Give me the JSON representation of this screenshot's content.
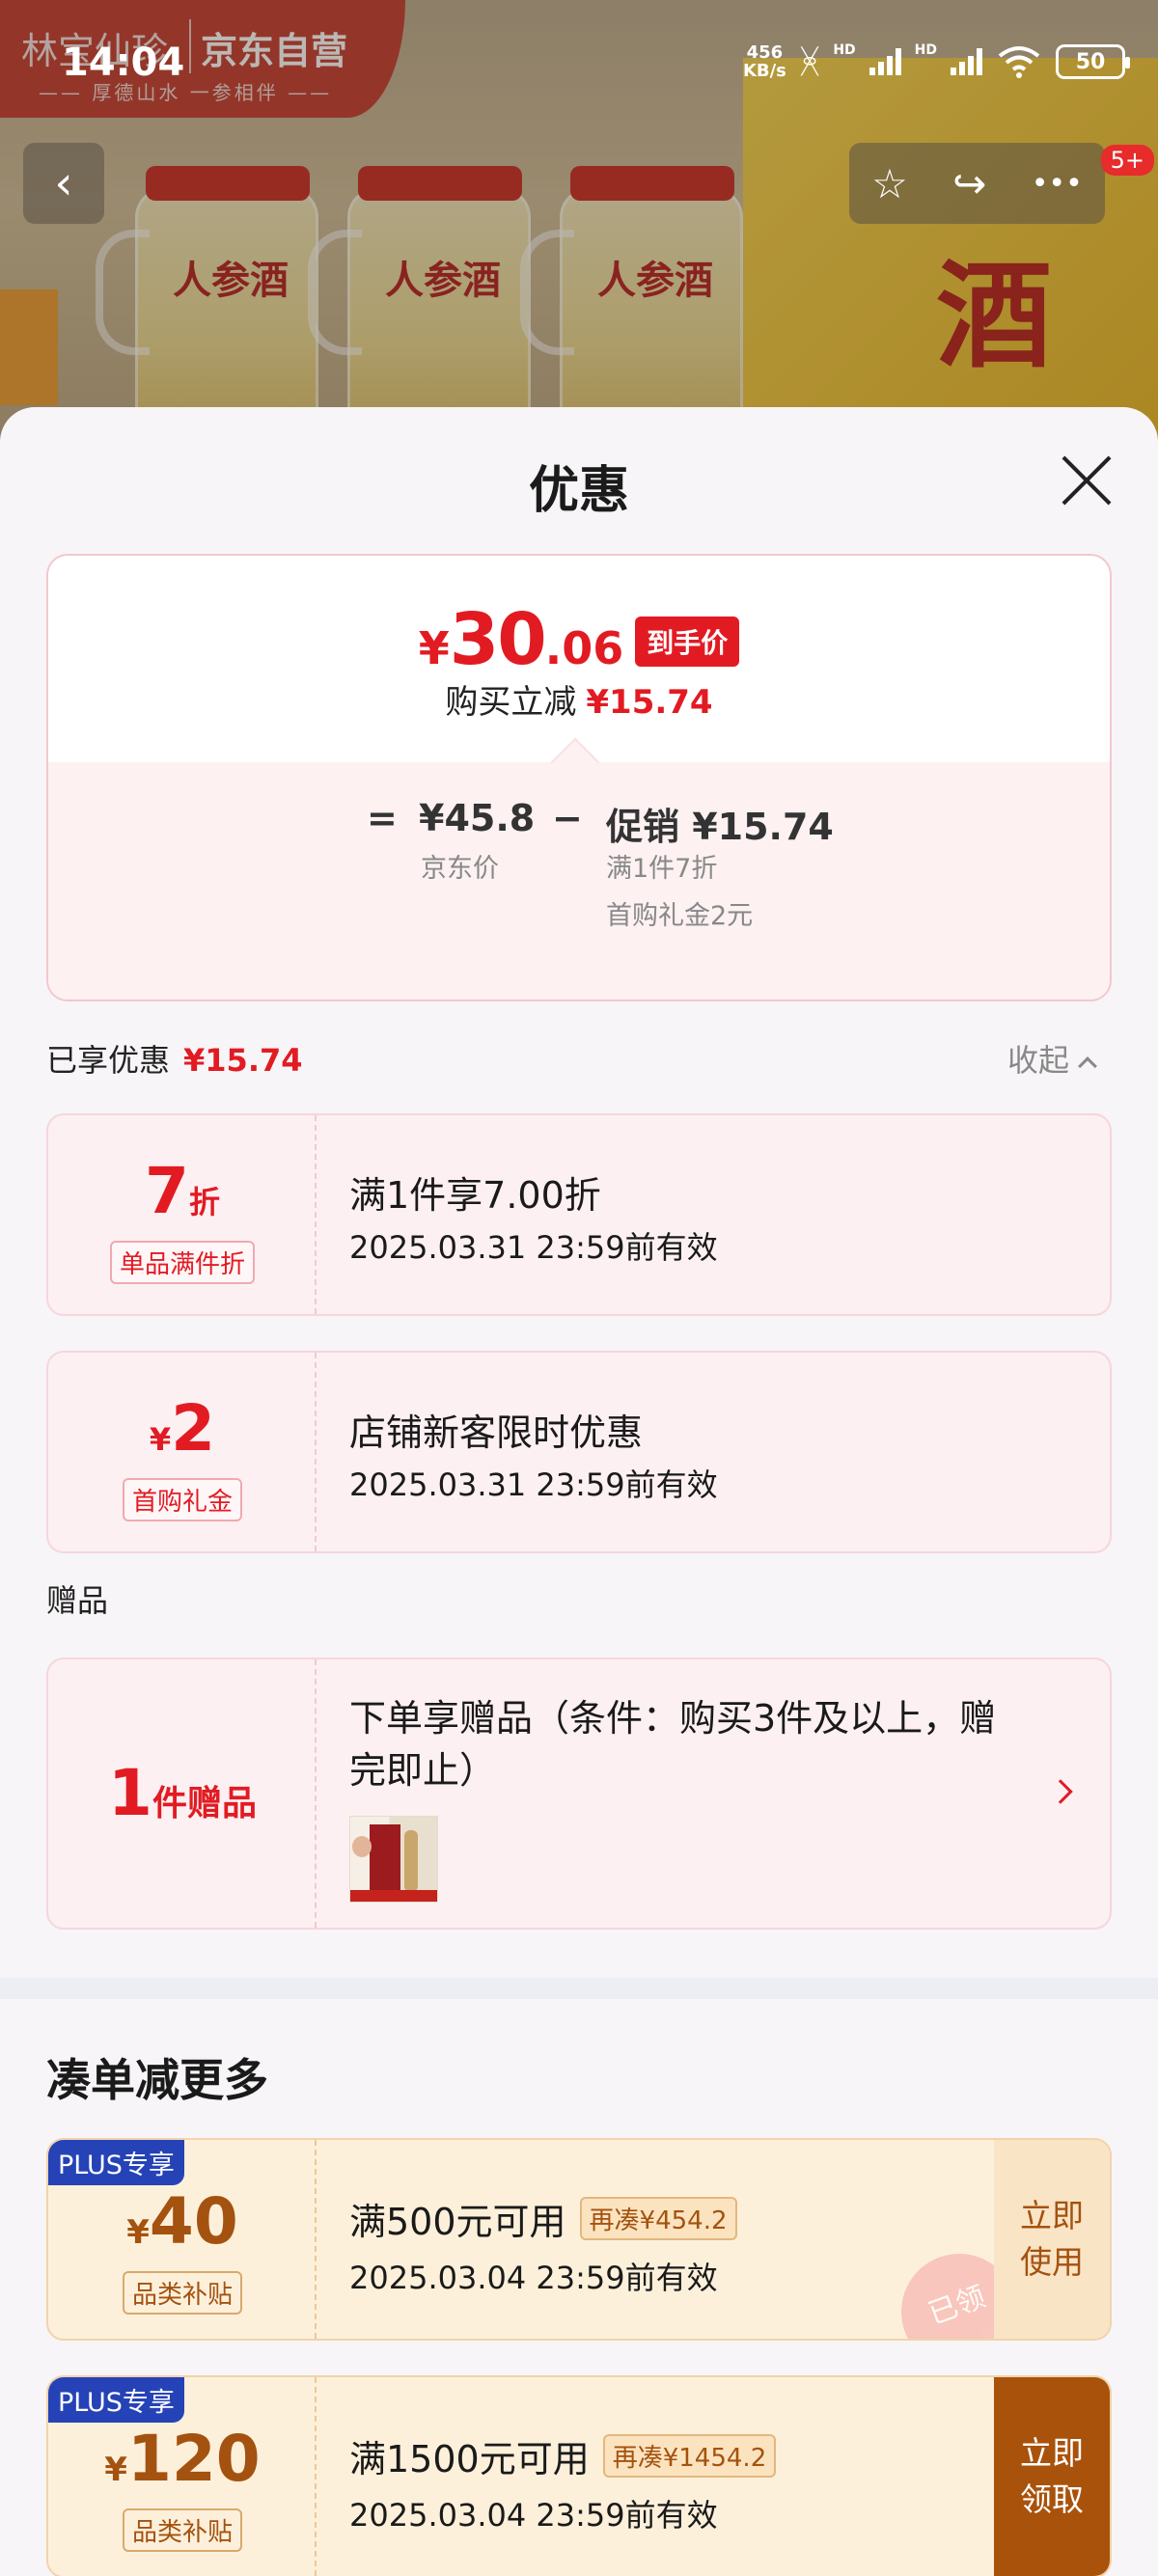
{
  "status_bar": {
    "time": "14:04",
    "net_speed_value": "456",
    "net_speed_unit": "KB/s",
    "hd1": "HD",
    "hd2": "HD",
    "battery": "50"
  },
  "product_header": {
    "brand_left": "林宝仙珍",
    "brand_right": "京东自营",
    "brand_slogan": "—— 厚德山水 一参相伴 ——",
    "jar_label": "人参酒",
    "box_label": "酒",
    "badge": "5+"
  },
  "sheet": {
    "title": "优惠",
    "price_summary": {
      "currency": "¥",
      "final_int": "30",
      "final_dec": ".06",
      "final_tag": "到手价",
      "reduce_label": "购买立减",
      "reduce_value": "¥15.74",
      "equals": "=",
      "jd_price": "¥45.8",
      "jd_price_label": "京东价",
      "minus": "−",
      "promo": "促销 ¥15.74",
      "promo_detail": "满1件7折",
      "gift_detail": "首购礼金2元"
    },
    "enjoyed": {
      "label": "已享优惠",
      "value": "¥15.74",
      "collapse": "收起"
    },
    "coupons": [
      {
        "value": "7",
        "unit": "折",
        "tag": "单品满件折",
        "title": "满1件享7.00折",
        "date": "2025.03.31 23:59前有效"
      },
      {
        "currency": "¥",
        "value": "2",
        "tag": "首购礼金",
        "title": "店铺新客限时优惠",
        "date": "2025.03.31 23:59前有效"
      }
    ],
    "gift_section": {
      "heading": "赠品",
      "count": "1",
      "unit": "件赠品",
      "title": "下单享赠品（条件：购买3件及以上，赠完即止）"
    },
    "more": {
      "heading": "凑单减更多",
      "coupons": [
        {
          "plus_tag": "PLUS专享",
          "currency": "¥",
          "value": "40",
          "tag": "品类补贴",
          "title": "满500元可用",
          "tip": "再凑¥454.2",
          "date": "2025.03.04 23:59前有效",
          "action": "立即使用",
          "stamp": "已领"
        },
        {
          "plus_tag": "PLUS专享",
          "currency": "¥",
          "value": "120",
          "tag": "品类补贴",
          "title": "满1500元可用",
          "tip": "再凑¥1454.2",
          "date": "2025.03.04 23:59前有效",
          "action": "立即领取"
        }
      ]
    }
  }
}
